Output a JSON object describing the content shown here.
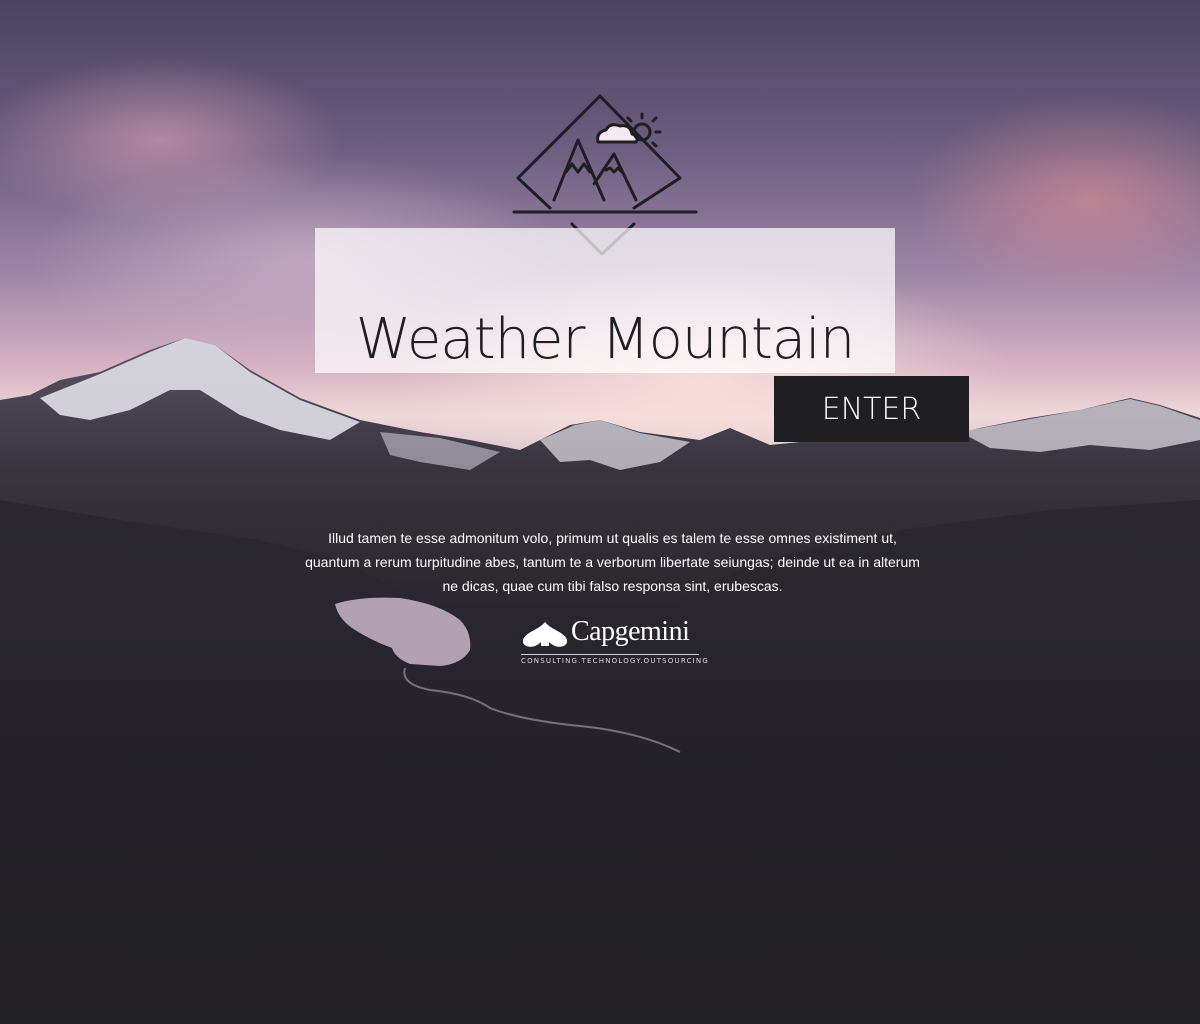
{
  "page": {
    "title": "Weather Mountain",
    "enter_label": "ENTER",
    "description": "Illud tamen te esse admonitum volo, primum ut qualis es talem te esse omnes existiment ut, quantum a rerum turpitudine abes, tantum te a verborum libertate seiungas; deinde ut ea in alterum ne dicas, quae cum tibi falso responsa sint, erubescas."
  },
  "logo": {
    "icon": "mountain-weather-icon"
  },
  "brand": {
    "name": "Capgemini",
    "tagline": "CONSULTING.TECHNOLOGY.OUTSOURCING",
    "icon": "spade-icon"
  },
  "colors": {
    "dark": "#1f1e22",
    "panel": "#ffffff",
    "text_light": "#ffffff"
  }
}
